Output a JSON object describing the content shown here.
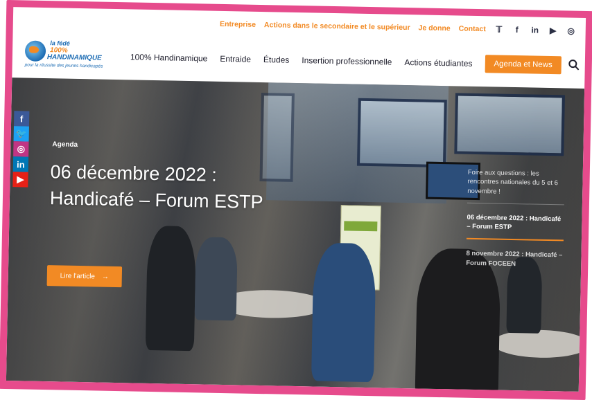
{
  "topbar": {
    "links": [
      "Entreprise",
      "Actions dans le secondaire et le supérieur",
      "Je donne",
      "Contact"
    ],
    "social": [
      {
        "icon": "twitter-icon",
        "glyph": "𝕋"
      },
      {
        "icon": "facebook-icon",
        "glyph": "f"
      },
      {
        "icon": "linkedin-icon",
        "glyph": "in"
      },
      {
        "icon": "youtube-icon",
        "glyph": "▶"
      },
      {
        "icon": "instagram-icon",
        "glyph": "◎"
      }
    ]
  },
  "logo": {
    "line1": "la fédé",
    "line2": "100%",
    "line3": "HANDINAMIQUE",
    "tagline": "pour la réussite des jeunes handicapés"
  },
  "nav": {
    "items": [
      "100% Handinamique",
      "Entraide",
      "Études",
      "Insertion professionnelle",
      "Actions étudiantes"
    ],
    "cta": "Agenda et News"
  },
  "hero": {
    "category": "Agenda",
    "title": "06 décembre 2022 : Handicafé – Forum ESTP",
    "read_more": "Lire l'article",
    "arrow": "→"
  },
  "side_list": [
    {
      "text": "Foire aux questions : les rencontres nationales du 5 et 6 novembre !",
      "state": "muted"
    },
    {
      "text": "06 décembre 2022 : Handicafé – Forum ESTP",
      "state": "active"
    },
    {
      "text": "8 novembre 2022 : Handicafé – Forum FOCEEN",
      "state": "plain"
    }
  ],
  "social_side": [
    {
      "icon": "facebook-icon",
      "glyph": "f",
      "color": "#3b5998"
    },
    {
      "icon": "twitter-icon",
      "glyph": "🐦",
      "color": "#1da1f2"
    },
    {
      "icon": "instagram-icon",
      "glyph": "◎",
      "color": "#c13584"
    },
    {
      "icon": "linkedin-icon",
      "glyph": "in",
      "color": "#0077b5"
    },
    {
      "icon": "youtube-icon",
      "glyph": "▶",
      "color": "#e62117"
    }
  ],
  "colors": {
    "accent": "#f28a24",
    "frame": "#e64b8c",
    "brand_blue": "#1e6db4"
  }
}
